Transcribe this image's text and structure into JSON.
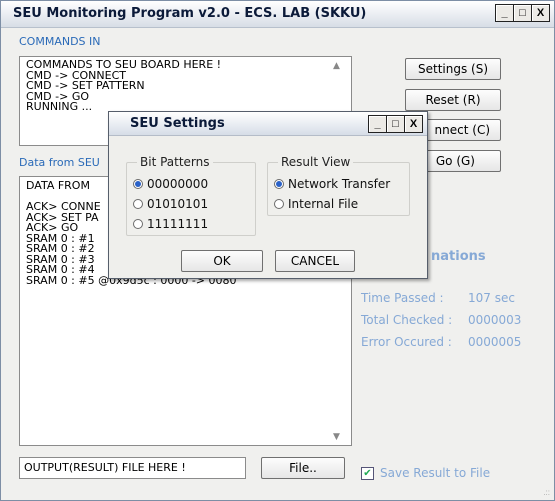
{
  "window": {
    "title": "SEU Monitoring Program v2.0 - ECS. LAB (SKKU)",
    "buttons": [
      "_",
      "□",
      "X"
    ]
  },
  "commands": {
    "section_label": "COMMANDS IN",
    "lines": [
      "COMMANDS TO SEU BOARD HERE !",
      "CMD -> CONNECT",
      "CMD -> SET PATTERN",
      "CMD -> GO",
      "RUNNING ..."
    ]
  },
  "data": {
    "section_label": "Data from SEU",
    "lines": [
      "DATA FROM",
      "",
      "ACK> CONNE",
      "ACK> SET PA",
      "ACK> GO",
      "SRAM 0 : #1",
      "SRAM 0 : #2",
      "SRAM 0 : #3",
      "SRAM 0 : #4",
      "SRAM 0 : #5 @0x9d5c : 0000 -> 0080"
    ]
  },
  "side_buttons": {
    "settings": "Settings (S)",
    "reset": "Reset (R)",
    "connect": "nnect (C)",
    "go": "Go (G)"
  },
  "info": {
    "heading": "nations",
    "time_label": "Time Passed :",
    "time_value": "107  sec",
    "checked_label": "Total Checked :",
    "checked_value": "0000003",
    "error_label": "Error Occured :",
    "error_value": "0000005"
  },
  "output": {
    "value": "OUTPUT(RESULT) FILE HERE !",
    "file_button": "File..",
    "save_checkbox_label": "Save Result to File",
    "save_checked": true
  },
  "dialog": {
    "title": "SEU Settings",
    "buttons": [
      "_",
      "□",
      "X"
    ],
    "bit_patterns": {
      "legend": "Bit Patterns",
      "options": [
        "00000000",
        "01010101",
        "11111111"
      ],
      "selected": 0
    },
    "result_view": {
      "legend": "Result View",
      "options": [
        "Network Transfer",
        "Internal File"
      ],
      "selected": 0
    },
    "ok": "OK",
    "cancel": "CANCEL"
  }
}
